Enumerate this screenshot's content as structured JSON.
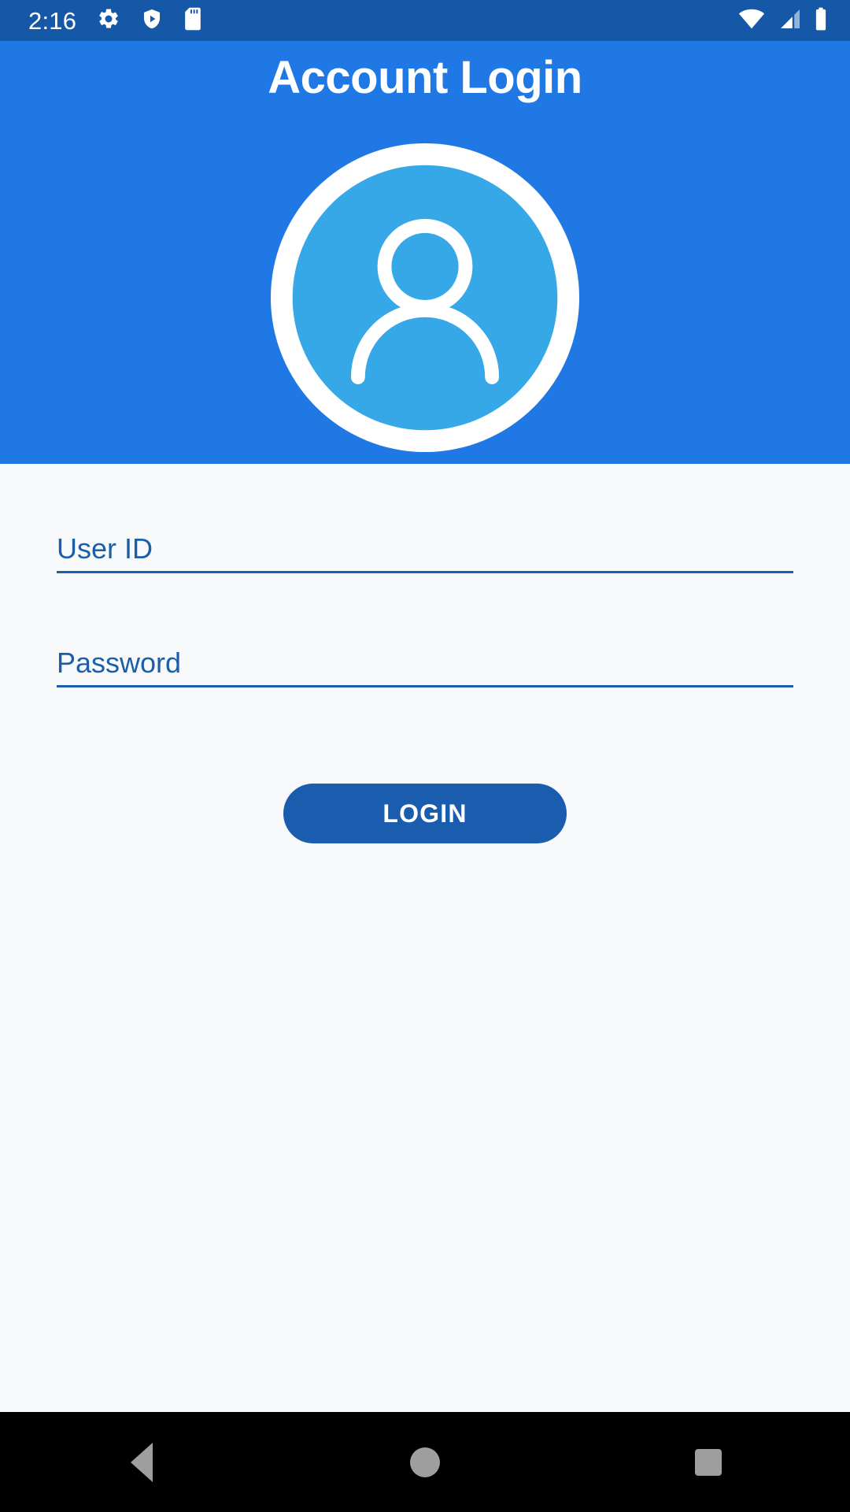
{
  "status_bar": {
    "time": "2:16",
    "left_icons": [
      "gear-icon",
      "shield-play-icon",
      "sd-card-icon"
    ],
    "right_icons": [
      "wifi-icon",
      "cellular-signal-icon",
      "battery-icon"
    ],
    "background_color": "#1658a8",
    "foreground_color": "#ffffff"
  },
  "header": {
    "title": "Account Login",
    "background_color": "#1f78e4",
    "avatar": {
      "icon": "user-avatar-icon",
      "ring_color": "#ffffff",
      "inner_color": "#36a8e8"
    }
  },
  "form": {
    "background_color": "#f8f9fa",
    "accent_color": "#1b5faa",
    "fields": [
      {
        "name": "user-id",
        "placeholder": "User ID",
        "value": "",
        "type": "text"
      },
      {
        "name": "password",
        "placeholder": "Password",
        "value": "",
        "type": "password"
      }
    ],
    "login_button": {
      "label": "LOGIN",
      "background_color": "#1a5cad",
      "text_color": "#ffffff"
    }
  },
  "nav_bar": {
    "background_color": "#000000",
    "icon_color": "#9e9e9e",
    "buttons": [
      {
        "name": "back",
        "icon": "back-triangle-icon"
      },
      {
        "name": "home",
        "icon": "home-circle-icon"
      },
      {
        "name": "recents",
        "icon": "recents-square-icon"
      }
    ]
  }
}
